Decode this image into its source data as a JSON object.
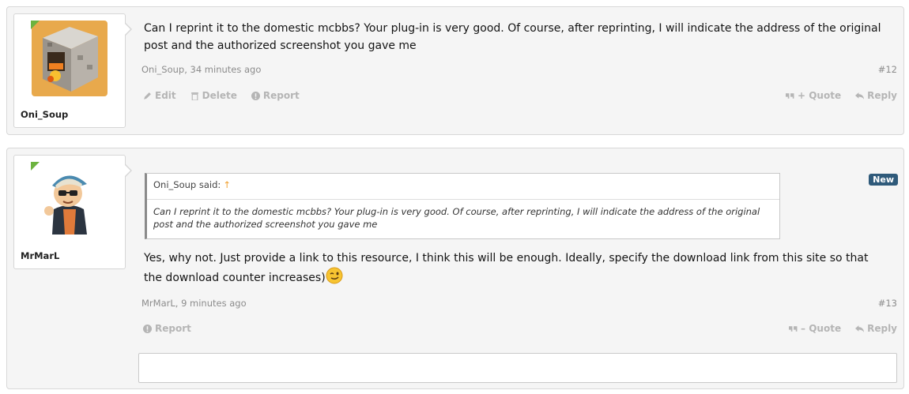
{
  "posts": [
    {
      "id": "12",
      "username": "Oni_Soup",
      "avatar_icon": "furnace-block-icon",
      "message": "Can I reprint it to the domestic mcbbs? Your plug-in is very good. Of course, after reprinting, I will indicate the address of the original post and the authorized screenshot you gave me",
      "meta": "Oni_Soup, 34 minutes ago",
      "permalink": "#12",
      "actions_left": [
        "Edit",
        "Delete",
        "Report"
      ],
      "actions_right": [
        "+ Quote",
        "Reply"
      ]
    },
    {
      "id": "13",
      "username": "MrMarL",
      "avatar_icon": "cartoon-boy-cap-icon",
      "badge": "New",
      "quote": {
        "author_said": "Oni_Soup said:",
        "body": "Can I reprint it to the domestic mcbbs? Your plug-in is very good. Of course, after reprinting, I will indicate the address of the original post and the authorized screenshot you gave me"
      },
      "message": "Yes, why not. Just provide a link to this resource, I think this will be enough. Ideally, specify the download link from this site so that the download counter increases)",
      "meta": "MrMarL, 9 minutes ago",
      "permalink": "#13",
      "actions_left": [
        "Report"
      ],
      "actions_right": [
        "– Quote",
        "Reply"
      ]
    }
  ],
  "colors": {
    "online": "#6cb33f",
    "badge": "#2f5a7a",
    "action": "#b5b5b5"
  }
}
